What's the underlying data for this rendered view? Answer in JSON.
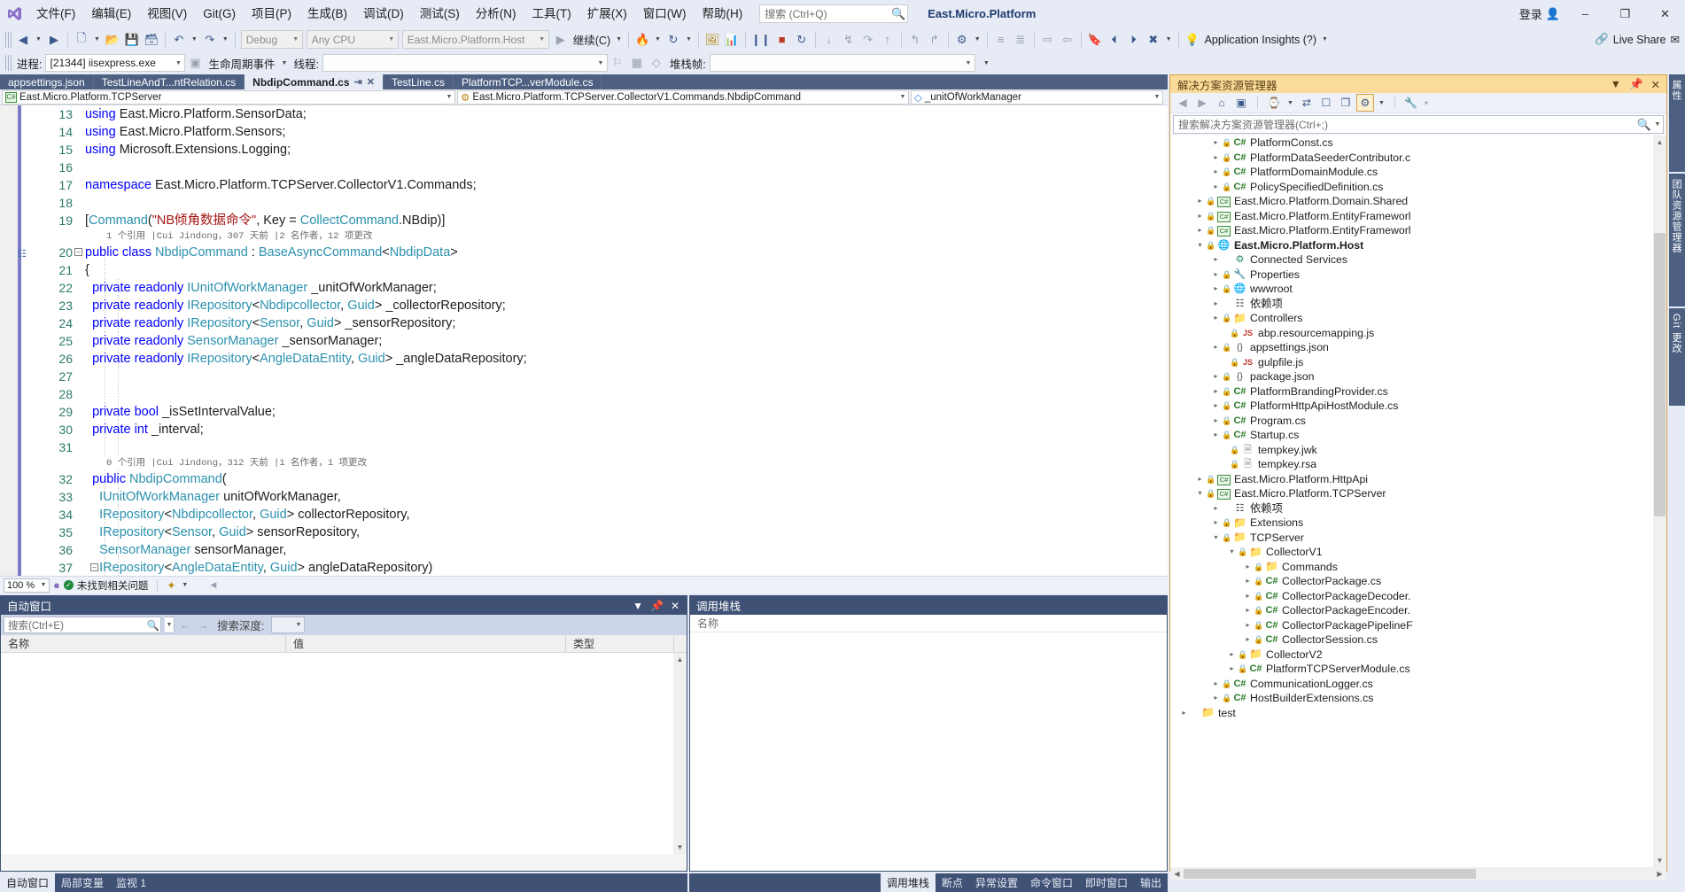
{
  "titlebar": {
    "logo_icon": "vs-logo-icon",
    "menus": [
      "文件(F)",
      "编辑(E)",
      "视图(V)",
      "Git(G)",
      "项目(P)",
      "生成(B)",
      "调试(D)",
      "测试(S)",
      "分析(N)",
      "工具(T)",
      "扩展(X)",
      "窗口(W)",
      "帮助(H)"
    ],
    "search_placeholder": "搜索 (Ctrl+Q)",
    "app_title": "East.Micro.Platform",
    "signin_label": "登录",
    "minimize": "–",
    "restore": "❐",
    "close": "✕"
  },
  "toolbar1": {
    "config": "Debug",
    "platform": "Any CPU",
    "startup_project": "East.Micro.Platform.Host",
    "continue_label": "继续(C)",
    "app_insights": "Application Insights (?)",
    "live_share": "Live Share"
  },
  "toolbar2": {
    "process_label": "进程:",
    "process_value": "[21344] iisexpress.exe",
    "lifecycle_label": "生命周期事件",
    "thread_label": "线程:",
    "thread_value": "",
    "stackframe_label": "堆栈帧:",
    "stackframe_value": ""
  },
  "document_tabs": [
    {
      "label": "appsettings.json",
      "active": false
    },
    {
      "label": "TestLineAndT...ntRelation.cs",
      "active": false
    },
    {
      "label": "NbdipCommand.cs",
      "active": true,
      "pin": "⇥",
      "close": "✕"
    },
    {
      "label": "TestLine.cs",
      "active": false
    },
    {
      "label": "PlatformTCP...verModule.cs",
      "active": false
    }
  ],
  "navbar": {
    "project": "East.Micro.Platform.TCPServer",
    "project_icon": "csharp-project-icon",
    "type": "East.Micro.Platform.TCPServer.CollectorV1.Commands.NbdipCommand",
    "type_icon": "class-icon",
    "member": "_unitOfWorkManager",
    "member_icon": "field-icon"
  },
  "code": {
    "lines": [
      {
        "num": "13",
        "html": "<span class='k'>using</span> <span class='n'>East.Micro.Platform.SensorData;</span>",
        "guide": false
      },
      {
        "num": "14",
        "html": "<span class='k'>using</span> <span class='n'>East.Micro.Platform.Sensors;</span>",
        "guide": false
      },
      {
        "num": "15",
        "html": "<span class='k'>using</span> <span class='n'>Microsoft.Extensions.Logging;</span>",
        "guide": false
      },
      {
        "num": "16",
        "html": "",
        "guide": false
      },
      {
        "num": "17",
        "html": "<span class='k'>namespace</span> <span class='n'>East.Micro.Platform.TCPServer.CollectorV1.Commands;</span>",
        "guide": false
      },
      {
        "num": "18",
        "html": "",
        "guide": false
      },
      {
        "num": "19",
        "html": "<span class='p'>[</span><span class='t'>Command</span><span class='p'>(</span><span class='s'>\"NB倾角数据命令\"</span><span class='p'>, </span><span class='n'>Key = </span><span class='t'>CollectCommand</span><span class='n'>.NBdip)]</span>",
        "guide": false
      },
      {
        "num": "20",
        "html": "<span class='k'>public class</span> <span class='t'>NbdipCommand</span> <span class='n'>: </span><span class='t'>BaseAsyncCommand</span><span class='p'>&lt;</span><span class='t'>NbdipData</span><span class='p'>&gt;</span>",
        "fold": true,
        "bookmark": true,
        "guide": false
      },
      {
        "num": "21",
        "html": "<span class='p'>{</span>",
        "guide": false
      },
      {
        "num": "22",
        "html": "  <span class='k'>private readonly</span> <span class='t'>IUnitOfWorkManager</span> <span class='n'>_unitOfWorkManager;</span>",
        "guide": true
      },
      {
        "num": "23",
        "html": "  <span class='k'>private readonly</span> <span class='t'>IRepository</span><span class='p'>&lt;</span><span class='t'>Nbdipcollector</span><span class='p'>, </span><span class='t'>Guid</span><span class='p'>&gt;</span> <span class='n'>_collectorRepository;</span>",
        "guide": true
      },
      {
        "num": "24",
        "html": "  <span class='k'>private readonly</span> <span class='t'>IRepository</span><span class='p'>&lt;</span><span class='t'>Sensor</span><span class='p'>, </span><span class='t'>Guid</span><span class='p'>&gt;</span> <span class='n'>_sensorRepository;</span>",
        "guide": true
      },
      {
        "num": "25",
        "html": "  <span class='k'>private readonly</span> <span class='t'>SensorManager</span> <span class='n'>_sensorManager;</span>",
        "guide": true
      },
      {
        "num": "26",
        "html": "  <span class='k'>private readonly</span> <span class='t'>IRepository</span><span class='p'>&lt;</span><span class='t'>AngleDataEntity</span><span class='p'>, </span><span class='t'>Guid</span><span class='p'>&gt;</span> <span class='n'>_angleDataRepository;</span>",
        "guide": true
      },
      {
        "num": "27",
        "html": "",
        "guide": true
      },
      {
        "num": "28",
        "html": "",
        "guide": true
      },
      {
        "num": "29",
        "html": "  <span class='k'>private bool</span> <span class='n'>_isSetIntervalValue;</span>",
        "guide": true
      },
      {
        "num": "30",
        "html": "  <span class='k'>private int</span> <span class='n'>_interval;</span>",
        "guide": true
      },
      {
        "num": "31",
        "html": "",
        "guide": true
      },
      {
        "num": "32",
        "html": "  <span class='k'>public</span> <span class='t'>NbdipCommand</span><span class='p'>(</span>",
        "guide": true
      },
      {
        "num": "33",
        "html": "    <span class='t'>IUnitOfWorkManager</span> <span class='n'>unitOfWorkManager,</span>",
        "guide": true
      },
      {
        "num": "34",
        "html": "    <span class='t'>IRepository</span><span class='p'>&lt;</span><span class='t'>Nbdipcollector</span><span class='p'>, </span><span class='t'>Guid</span><span class='p'>&gt;</span> <span class='n'>collectorRepository,</span>",
        "guide": true
      },
      {
        "num": "35",
        "html": "    <span class='t'>IRepository</span><span class='p'>&lt;</span><span class='t'>Sensor</span><span class='p'>, </span><span class='t'>Guid</span><span class='p'>&gt;</span> <span class='n'>sensorRepository,</span>",
        "guide": true
      },
      {
        "num": "36",
        "html": "    <span class='t'>SensorManager</span> <span class='n'>sensorManager,</span>",
        "guide": true
      },
      {
        "num": "37",
        "html": "    <span class='t'>IRepository</span><span class='p'>&lt;</span><span class='t'>AngleDataEntity</span><span class='p'>, </span><span class='t'>Guid</span><span class='p'>&gt;</span> <span class='n'>angleDataRepository)</span>",
        "guide": true,
        "fold2": true
      },
      {
        "num": "38",
        "html": "  <span class='p'>{</span>",
        "guide": true
      }
    ],
    "codelens_1": "1 个引用 |Cui Jindong，307 天前 |2 名作者，12 项更改",
    "codelens_2": "0 个引用 |Cui Jindong，312 天前 |1 名作者，1 项更改"
  },
  "editor_status": {
    "zoom": "100 %",
    "issues": "未找到相关问题",
    "ok_icon": "checkmark-icon"
  },
  "autos_panel": {
    "title": "自动窗口",
    "search_placeholder": "搜索(Ctrl+E)",
    "depth_label": "搜索深度:",
    "depth_value": "",
    "columns": [
      "名称",
      "值",
      "类型"
    ],
    "rows": []
  },
  "callstack_panel": {
    "title": "调用堆栈",
    "columns": [
      "名称"
    ],
    "rows": []
  },
  "bottom_tabs_left": [
    {
      "label": "自动窗口",
      "active": true
    },
    {
      "label": "局部变量",
      "active": false
    },
    {
      "label": "监视 1",
      "active": false
    }
  ],
  "bottom_tabs_right": [
    {
      "label": "调用堆栈",
      "active": true
    },
    {
      "label": "断点",
      "active": false
    },
    {
      "label": "异常设置",
      "active": false
    },
    {
      "label": "命令窗口",
      "active": false
    },
    {
      "label": "即时窗口",
      "active": false
    },
    {
      "label": "输出",
      "active": false
    }
  ],
  "solution_explorer": {
    "title": "解决方案资源管理器",
    "search_placeholder": "搜索解决方案资源管理器(Ctrl+;)",
    "tree": [
      {
        "indent": 5,
        "tri": "▷",
        "lock": true,
        "icon": "cs",
        "label": "PlatformConst.cs",
        "bold": false
      },
      {
        "indent": 5,
        "tri": "▷",
        "lock": true,
        "icon": "cs",
        "label": "PlatformDataSeederContributor.c",
        "bold": false
      },
      {
        "indent": 5,
        "tri": "▷",
        "lock": true,
        "icon": "cs",
        "label": "PlatformDomainModule.cs",
        "bold": false
      },
      {
        "indent": 5,
        "tri": "▷",
        "lock": true,
        "icon": "cs",
        "label": "PolicySpecifiedDefinition.cs",
        "bold": false
      },
      {
        "indent": 3,
        "tri": "▷",
        "lock": true,
        "icon": "proj",
        "label": "East.Micro.Platform.Domain.Shared",
        "bold": false
      },
      {
        "indent": 3,
        "tri": "▷",
        "lock": true,
        "icon": "proj",
        "label": "East.Micro.Platform.EntityFrameworl",
        "bold": false
      },
      {
        "indent": 3,
        "tri": "▷",
        "lock": true,
        "icon": "proj",
        "label": "East.Micro.Platform.EntityFrameworl",
        "bold": false
      },
      {
        "indent": 3,
        "tri": "▲",
        "lock": true,
        "icon": "web",
        "label": "East.Micro.Platform.Host",
        "bold": true
      },
      {
        "indent": 5,
        "tri": "▷",
        "lock": false,
        "icon": "connected",
        "label": "Connected Services",
        "bold": false
      },
      {
        "indent": 5,
        "tri": "▷",
        "lock": true,
        "icon": "props",
        "label": "Properties",
        "bold": false
      },
      {
        "indent": 5,
        "tri": "▷",
        "lock": true,
        "icon": "globe",
        "label": "wwwroot",
        "bold": false
      },
      {
        "indent": 5,
        "tri": "▷",
        "lock": false,
        "icon": "deps",
        "label": "依赖项",
        "bold": false
      },
      {
        "indent": 5,
        "tri": "▷",
        "lock": true,
        "icon": "folder",
        "label": "Controllers",
        "bold": false
      },
      {
        "indent": 6,
        "tri": "",
        "lock": true,
        "icon": "js",
        "label": "abp.resourcemapping.js",
        "bold": false
      },
      {
        "indent": 5,
        "tri": "▷",
        "lock": true,
        "icon": "json",
        "label": "appsettings.json",
        "bold": false
      },
      {
        "indent": 6,
        "tri": "",
        "lock": true,
        "icon": "js",
        "label": "gulpfile.js",
        "bold": false
      },
      {
        "indent": 5,
        "tri": "▷",
        "lock": true,
        "icon": "json",
        "label": "package.json",
        "bold": false
      },
      {
        "indent": 5,
        "tri": "▷",
        "lock": true,
        "icon": "cs",
        "label": "PlatformBrandingProvider.cs",
        "bold": false
      },
      {
        "indent": 5,
        "tri": "▷",
        "lock": true,
        "icon": "cs",
        "label": "PlatformHttpApiHostModule.cs",
        "bold": false
      },
      {
        "indent": 5,
        "tri": "▷",
        "lock": true,
        "icon": "cs",
        "label": "Program.cs",
        "bold": false
      },
      {
        "indent": 5,
        "tri": "▷",
        "lock": true,
        "icon": "cs",
        "label": "Startup.cs",
        "bold": false
      },
      {
        "indent": 6,
        "tri": "",
        "lock": true,
        "icon": "file",
        "label": "tempkey.jwk",
        "bold": false
      },
      {
        "indent": 6,
        "tri": "",
        "lock": true,
        "icon": "file",
        "label": "tempkey.rsa",
        "bold": false
      },
      {
        "indent": 3,
        "tri": "▷",
        "lock": true,
        "icon": "proj",
        "label": "East.Micro.Platform.HttpApi",
        "bold": false
      },
      {
        "indent": 3,
        "tri": "▲",
        "lock": true,
        "icon": "proj",
        "label": "East.Micro.Platform.TCPServer",
        "bold": false
      },
      {
        "indent": 5,
        "tri": "▷",
        "lock": false,
        "icon": "deps",
        "label": "依赖项",
        "bold": false
      },
      {
        "indent": 5,
        "tri": "▷",
        "lock": true,
        "icon": "folder",
        "label": "Extensions",
        "bold": false
      },
      {
        "indent": 5,
        "tri": "▲",
        "lock": true,
        "icon": "folder",
        "label": "TCPServer",
        "bold": false
      },
      {
        "indent": 7,
        "tri": "▲",
        "lock": true,
        "icon": "folder",
        "label": "CollectorV1",
        "bold": false
      },
      {
        "indent": 9,
        "tri": "▷",
        "lock": true,
        "icon": "folder",
        "label": "Commands",
        "bold": false
      },
      {
        "indent": 9,
        "tri": "▷",
        "lock": true,
        "icon": "cs",
        "label": "CollectorPackage.cs",
        "bold": false
      },
      {
        "indent": 9,
        "tri": "▷",
        "lock": true,
        "icon": "cs",
        "label": "CollectorPackageDecoder.",
        "bold": false
      },
      {
        "indent": 9,
        "tri": "▷",
        "lock": true,
        "icon": "cs",
        "label": "CollectorPackageEncoder.",
        "bold": false
      },
      {
        "indent": 9,
        "tri": "▷",
        "lock": true,
        "icon": "cs",
        "label": "CollectorPackagePipelineF",
        "bold": false
      },
      {
        "indent": 9,
        "tri": "▷",
        "lock": true,
        "icon": "cs",
        "label": "CollectorSession.cs",
        "bold": false
      },
      {
        "indent": 7,
        "tri": "▷",
        "lock": true,
        "icon": "folder",
        "label": "CollectorV2",
        "bold": false
      },
      {
        "indent": 7,
        "tri": "▷",
        "lock": true,
        "icon": "cs",
        "label": "PlatformTCPServerModule.cs",
        "bold": false
      },
      {
        "indent": 5,
        "tri": "▷",
        "lock": true,
        "icon": "cs",
        "label": "CommunicationLogger.cs",
        "bold": false
      },
      {
        "indent": 5,
        "tri": "▷",
        "lock": true,
        "icon": "cs",
        "label": "HostBuilderExtensions.cs",
        "bold": false
      },
      {
        "indent": 1,
        "tri": "▷",
        "lock": false,
        "icon": "folder",
        "label": "test",
        "bold": false
      }
    ]
  },
  "side_tabs": [
    "属性",
    "团队资源管理器",
    "Git 更改"
  ]
}
